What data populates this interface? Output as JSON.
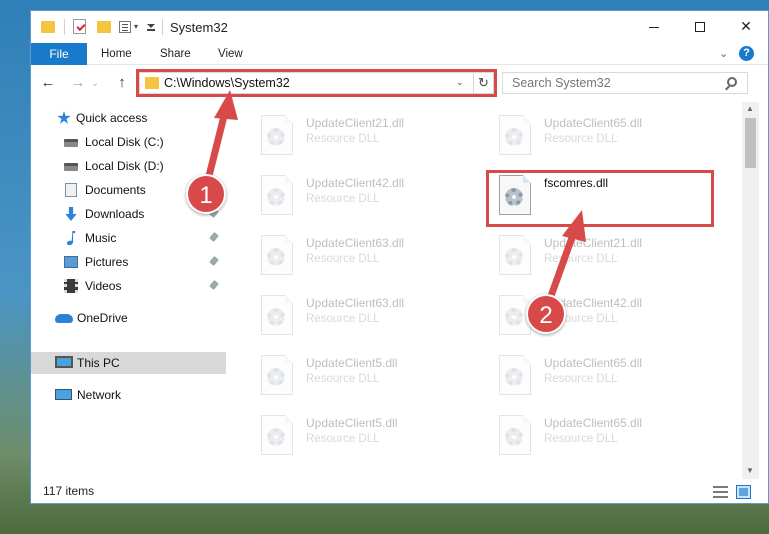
{
  "window": {
    "title": "System32",
    "controls": {
      "minimize": "",
      "maximize": "",
      "close": "✕"
    }
  },
  "ribbon": {
    "tabs": [
      "File",
      "Home",
      "Share",
      "View"
    ],
    "expand": "⌄",
    "help": "?"
  },
  "nav": {
    "back": "←",
    "forward": "→",
    "recent": "⌄",
    "up": "↑",
    "address": "C:\\Windows\\System32",
    "address_dropdown": "⌄",
    "refresh": "↻",
    "search_placeholder": "Search System32"
  },
  "sidebar": {
    "items": [
      {
        "label": "Quick access",
        "icon": "star-icon",
        "pinned": false
      },
      {
        "label": "Local Disk (C:)",
        "icon": "disk-icon",
        "pinned": false
      },
      {
        "label": "Local Disk (D:)",
        "icon": "disk-icon",
        "pinned": false
      },
      {
        "label": "Documents",
        "icon": "documents-icon",
        "pinned": true
      },
      {
        "label": "Downloads",
        "icon": "download-icon",
        "pinned": true
      },
      {
        "label": "Music",
        "icon": "music-icon",
        "pinned": true
      },
      {
        "label": "Pictures",
        "icon": "pictures-icon",
        "pinned": true
      },
      {
        "label": "Videos",
        "icon": "videos-icon",
        "pinned": true
      },
      {
        "label": "OneDrive",
        "icon": "cloud-icon",
        "pinned": false
      },
      {
        "label": "This PC",
        "icon": "computer-icon",
        "pinned": false,
        "selected": true
      },
      {
        "label": "Network",
        "icon": "network-icon",
        "pinned": false
      }
    ]
  },
  "files": {
    "left": [
      {
        "name": "UpdateClient21.dll",
        "type": "Resource DLL"
      },
      {
        "name": "UpdateClient42.dll",
        "type": "Resource DLL"
      },
      {
        "name": "UpdateClient63.dll",
        "type": "Resource DLL"
      },
      {
        "name": "UpdateClient63.dll",
        "type": "Resource DLL"
      },
      {
        "name": "UpdateClient5.dll",
        "type": "Resource DLL"
      },
      {
        "name": "UpdateClient5.dll",
        "type": "Resource DLL"
      }
    ],
    "right": [
      {
        "name": "UpdateClient65.dll",
        "type": "Resource DLL"
      },
      {
        "name": "fscomres.dll",
        "type": ""
      },
      {
        "name": "UpdateClient21.dll",
        "type": "Resource DLL"
      },
      {
        "name": "UpdateClient42.dll",
        "type": "Resource DLL"
      },
      {
        "name": "UpdateClient65.dll",
        "type": "Resource DLL"
      },
      {
        "name": "UpdateClient65.dll",
        "type": "Resource DLL"
      }
    ]
  },
  "status": {
    "item_count": "117 items"
  },
  "callouts": {
    "step1": "1",
    "step2": "2"
  },
  "colors": {
    "accent": "#1979ca",
    "highlight": "#d84a4a",
    "selected_bg": "#d9d9d9"
  }
}
